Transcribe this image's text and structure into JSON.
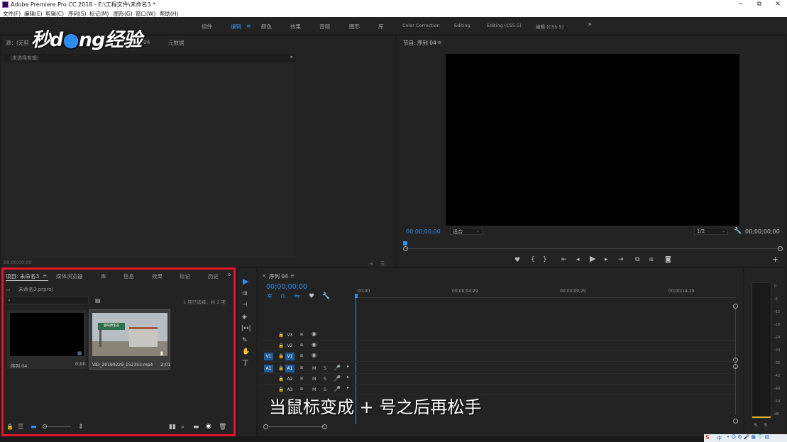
{
  "window": {
    "title": "Adobe Premiere Pro CC 2018 - E:\\工程文件\\未命名3 *",
    "minimize": "−",
    "maximize": "⧉",
    "close": "✕"
  },
  "menu": [
    "文件(F)",
    "编辑(E)",
    "剪辑(C)",
    "序列(S)",
    "标记(M)",
    "图形(G)",
    "窗口(W)",
    "帮助(H)"
  ],
  "workspaces": [
    "组件",
    "编辑",
    "颜色",
    "效果",
    "音频",
    "图形",
    "库",
    "Color Correction",
    "Editing",
    "Editing (CS5.5)",
    "编辑 (CS5.5)",
    "»"
  ],
  "watermark": {
    "part1": "秒d",
    "part2": "ng经验"
  },
  "source_panel": {
    "tab": "源：(无剪",
    "tab2": "04",
    "tab3": "元数据",
    "no_clip": "（未选择剪辑）",
    "timecode": "00;00;00;00"
  },
  "program_monitor": {
    "tab": "节目: 序列 04",
    "timecode_left": "00;00;00;00",
    "fit": "适合",
    "resolution": "1/2",
    "timecode_right": "00;00;00;00"
  },
  "project_panel": {
    "tabs": [
      "项目: 未命名3",
      "媒体浏览器",
      "库",
      "信息",
      "效果",
      "标记",
      "历史"
    ],
    "project_file": "未命名3.prproj",
    "selection_info": "1 项已选择，共 2 项",
    "items": [
      {
        "name": "序列 04",
        "duration": "0;00"
      },
      {
        "name": "VID_20190229_152353.mp4",
        "duration": "2;01"
      }
    ],
    "thumbnail_sign": "金阳原生态"
  },
  "timeline": {
    "tab": "序列 04",
    "timecode": "00;00;00;00",
    "ruler": [
      ":00;00",
      "00;00;04;29",
      "00;00;09;29",
      "00;00;14;29"
    ],
    "video_tracks": [
      "V3",
      "V2",
      "V1"
    ],
    "audio_tracks": [
      "A1",
      "A2",
      "A3"
    ],
    "source_patch_v": "V1",
    "source_patch_a": "A1",
    "mute": "M",
    "solo": "S"
  },
  "audio_meter": {
    "scale": [
      "0",
      "-6",
      "-12",
      "-18",
      "-24",
      "-30",
      "-36",
      "-42",
      "-48",
      "-54",
      "dB"
    ],
    "solo_left": "S",
    "solo_right": "S"
  },
  "tools": [
    "selection-tool",
    "track-select-tool",
    "ripple-edit-tool",
    "razor-tool",
    "slip-tool",
    "pen-tool",
    "hand-tool",
    "type-tool"
  ],
  "subtitle": "当鼠标变成 + 号之后再松手",
  "taskbar": {
    "ime": "S",
    "lang": "中"
  }
}
